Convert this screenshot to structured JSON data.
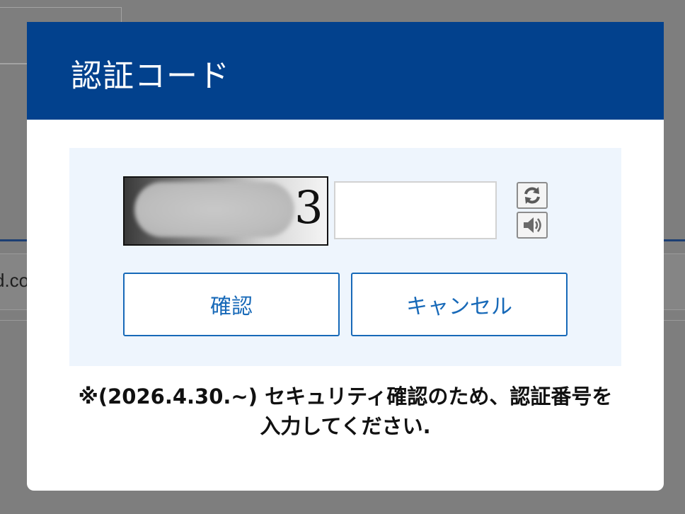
{
  "background": {
    "partial_field_text": "d.co"
  },
  "modal": {
    "title": "認証コード",
    "captcha": {
      "input_value": "",
      "refresh_icon": "refresh-icon",
      "audio_icon": "speaker-icon"
    },
    "buttons": {
      "confirm_label": "確認",
      "cancel_label": "キャンセル"
    },
    "notice": {
      "line1": "※(2026.4.30.~) セキュリティ確認のため、認証番号を",
      "line2": "入力してください."
    },
    "colors": {
      "header": "#02418d",
      "panel": "#eef5fd",
      "button_accent": "#1769b8"
    }
  }
}
